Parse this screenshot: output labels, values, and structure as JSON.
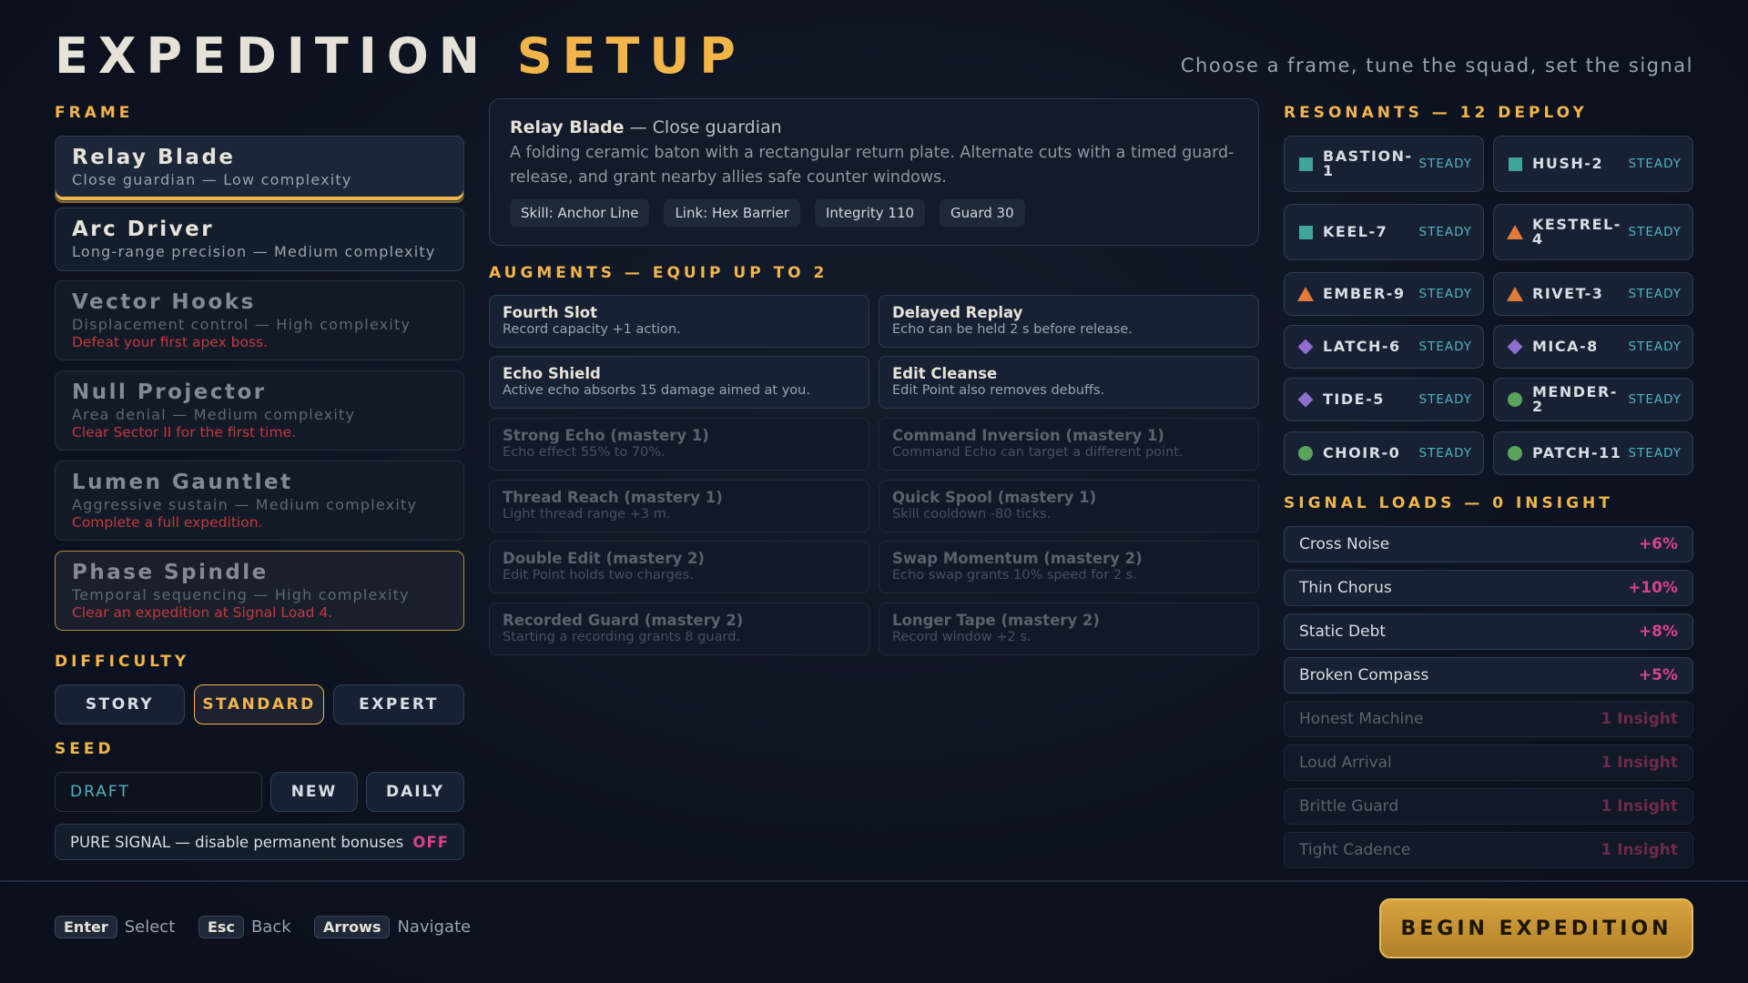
{
  "header": {
    "title_main": "EXPEDITION",
    "title_accent": "SETUP",
    "subtitle": "Choose a frame, tune the squad, set the signal"
  },
  "frame": {
    "label": "FRAME",
    "items": [
      {
        "name": "Relay Blade",
        "desc": "Close guardian — Low complexity",
        "lock": "",
        "state": "selected"
      },
      {
        "name": "Arc Driver",
        "desc": "Long-range precision — Medium complexity",
        "lock": "",
        "state": "available"
      },
      {
        "name": "Vector Hooks",
        "desc": "Displacement control — High complexity",
        "lock": "Defeat your first apex boss.",
        "state": "locked"
      },
      {
        "name": "Null Projector",
        "desc": "Area denial — Medium complexity",
        "lock": "Clear Sector II for the first time.",
        "state": "locked"
      },
      {
        "name": "Lumen Gauntlet",
        "desc": "Aggressive sustain — Medium complexity",
        "lock": "Complete a full expedition.",
        "state": "locked"
      },
      {
        "name": "Phase Spindle",
        "desc": "Temporal sequencing — High complexity",
        "lock": "Clear an expedition at Signal Load 4.",
        "state": "locked-highlight"
      }
    ]
  },
  "difficulty": {
    "label": "DIFFICULTY",
    "options": [
      "STORY",
      "STANDARD",
      "EXPERT"
    ],
    "selected": "STANDARD"
  },
  "seed": {
    "label": "SEED",
    "value": "DRAFT",
    "new_label": "NEW",
    "daily_label": "DAILY"
  },
  "pure_signal": {
    "label": "PURE SIGNAL — disable permanent bonuses",
    "state": "OFF"
  },
  "detail": {
    "name": "Relay Blade",
    "role": " — Close guardian",
    "body": "A folding ceramic baton with a rectangular return plate. Alternate cuts with a timed guard-release, and grant nearby allies safe counter windows.",
    "chips": [
      "Skill: Anchor Line",
      "Link: Hex Barrier",
      "Integrity 110",
      "Guard 30"
    ]
  },
  "augments": {
    "label": "AUGMENTS — EQUIP UP TO 2",
    "items": [
      {
        "name": "Fourth Slot",
        "desc": "Record capacity +1 action.",
        "available": true
      },
      {
        "name": "Delayed Replay",
        "desc": "Echo can be held 2 s before release.",
        "available": true
      },
      {
        "name": "Echo Shield",
        "desc": "Active echo absorbs 15 damage aimed at you.",
        "available": true
      },
      {
        "name": "Edit Cleanse",
        "desc": "Edit Point also removes debuffs.",
        "available": true
      },
      {
        "name": "Strong Echo (mastery 1)",
        "desc": "Echo effect 55% to 70%.",
        "available": false
      },
      {
        "name": "Command Inversion (mastery 1)",
        "desc": "Command Echo can target a different point.",
        "available": false
      },
      {
        "name": "Thread Reach (mastery 1)",
        "desc": "Light thread range +3 m.",
        "available": false
      },
      {
        "name": "Quick Spool (mastery 1)",
        "desc": "Skill cooldown -80 ticks.",
        "available": false
      },
      {
        "name": "Double Edit (mastery 2)",
        "desc": "Edit Point holds two charges.",
        "available": false
      },
      {
        "name": "Swap Momentum (mastery 2)",
        "desc": "Echo swap grants 10% speed for 2 s.",
        "available": false
      },
      {
        "name": "Recorded Guard (mastery 2)",
        "desc": "Starting a recording grants 8 guard.",
        "available": false
      },
      {
        "name": "Longer Tape (mastery 2)",
        "desc": "Record window +2 s.",
        "available": false
      }
    ]
  },
  "resonants": {
    "label": "RESONANTS — 12 DEPLOY",
    "items": [
      {
        "name": "BASTION-1",
        "status": "STEADY",
        "icon": "square-icon",
        "color": "#3fa49c"
      },
      {
        "name": "HUSH-2",
        "status": "STEADY",
        "icon": "square-icon",
        "color": "#3fa49c"
      },
      {
        "name": "KEEL-7",
        "status": "STEADY",
        "icon": "square-icon",
        "color": "#3fa49c"
      },
      {
        "name": "KESTREL-4",
        "status": "STEADY",
        "icon": "triangle-icon",
        "color": "#e07b3a"
      },
      {
        "name": "EMBER-9",
        "status": "STEADY",
        "icon": "triangle-icon",
        "color": "#e07b3a"
      },
      {
        "name": "RIVET-3",
        "status": "STEADY",
        "icon": "triangle-icon",
        "color": "#e07b3a"
      },
      {
        "name": "LATCH-6",
        "status": "STEADY",
        "icon": "diamond-icon",
        "color": "#8e6fd0"
      },
      {
        "name": "MICA-8",
        "status": "STEADY",
        "icon": "diamond-icon",
        "color": "#8e6fd0"
      },
      {
        "name": "TIDE-5",
        "status": "STEADY",
        "icon": "diamond-icon",
        "color": "#8e6fd0"
      },
      {
        "name": "MENDER-2",
        "status": "STEADY",
        "icon": "circle-icon",
        "color": "#5aa35a"
      },
      {
        "name": "CHOIR-0",
        "status": "STEADY",
        "icon": "circle-icon",
        "color": "#5aa35a"
      },
      {
        "name": "PATCH-11",
        "status": "STEADY",
        "icon": "circle-icon",
        "color": "#5aa35a"
      }
    ]
  },
  "signal_loads": {
    "label": "SIGNAL LOADS — 0 INSIGHT",
    "items": [
      {
        "name": "Cross Noise",
        "value": "+6%",
        "available": true
      },
      {
        "name": "Thin Chorus",
        "value": "+10%",
        "available": true
      },
      {
        "name": "Static Debt",
        "value": "+8%",
        "available": true
      },
      {
        "name": "Broken Compass",
        "value": "+5%",
        "available": true
      },
      {
        "name": "Honest Machine",
        "value": "1 Insight",
        "available": false
      },
      {
        "name": "Loud Arrival",
        "value": "1 Insight",
        "available": false
      },
      {
        "name": "Brittle Guard",
        "value": "1 Insight",
        "available": false
      },
      {
        "name": "Tight Cadence",
        "value": "1 Insight",
        "available": false
      }
    ]
  },
  "footer": {
    "hints": [
      {
        "key": "Enter",
        "label": "Select"
      },
      {
        "key": "Esc",
        "label": "Back"
      },
      {
        "key": "Arrows",
        "label": "Navigate"
      }
    ],
    "begin_label": "BEGIN EXPEDITION"
  },
  "colors": {
    "accent": "#f2b54a",
    "status_steady": "#4fb3c2",
    "load_value": "#d8428c",
    "lock_text": "#c2393d"
  }
}
